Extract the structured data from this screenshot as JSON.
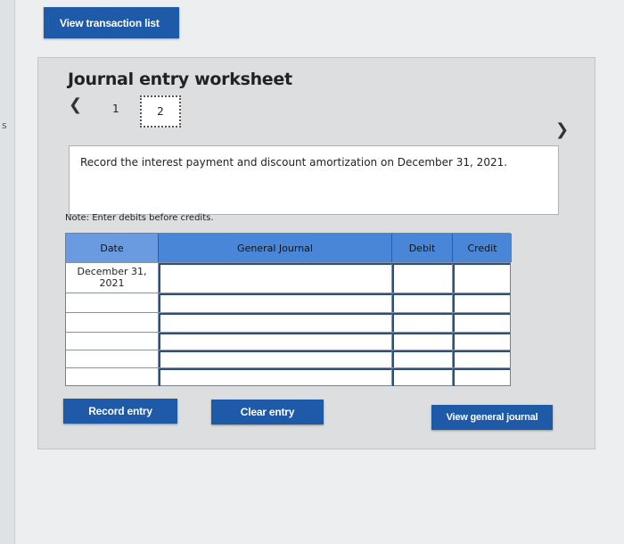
{
  "sidebar": {
    "mark": "s"
  },
  "header": {
    "view_transaction_list": "View transaction list"
  },
  "worksheet": {
    "title": "Journal entry worksheet",
    "steps": [
      "1",
      "2"
    ],
    "instruction": "Record the interest payment and discount amortization on December 31, 2021.",
    "note": "Note: Enter debits before credits."
  },
  "table": {
    "headers": {
      "date": "Date",
      "general_journal": "General Journal",
      "debit": "Debit",
      "credit": "Credit"
    },
    "rows": [
      {
        "date": "December 31, 2021",
        "general_journal": "",
        "debit": "",
        "credit": ""
      },
      {
        "date": "",
        "general_journal": "",
        "debit": "",
        "credit": ""
      },
      {
        "date": "",
        "general_journal": "",
        "debit": "",
        "credit": ""
      },
      {
        "date": "",
        "general_journal": "",
        "debit": "",
        "credit": ""
      },
      {
        "date": "",
        "general_journal": "",
        "debit": "",
        "credit": ""
      },
      {
        "date": "",
        "general_journal": "",
        "debit": "",
        "credit": ""
      }
    ]
  },
  "buttons": {
    "record_entry": "Record entry",
    "clear_entry": "Clear entry",
    "view_general_journal": "View general journal"
  },
  "colors": {
    "button_blue": "#1e5aa8",
    "header_blue": "#4a86d8"
  }
}
